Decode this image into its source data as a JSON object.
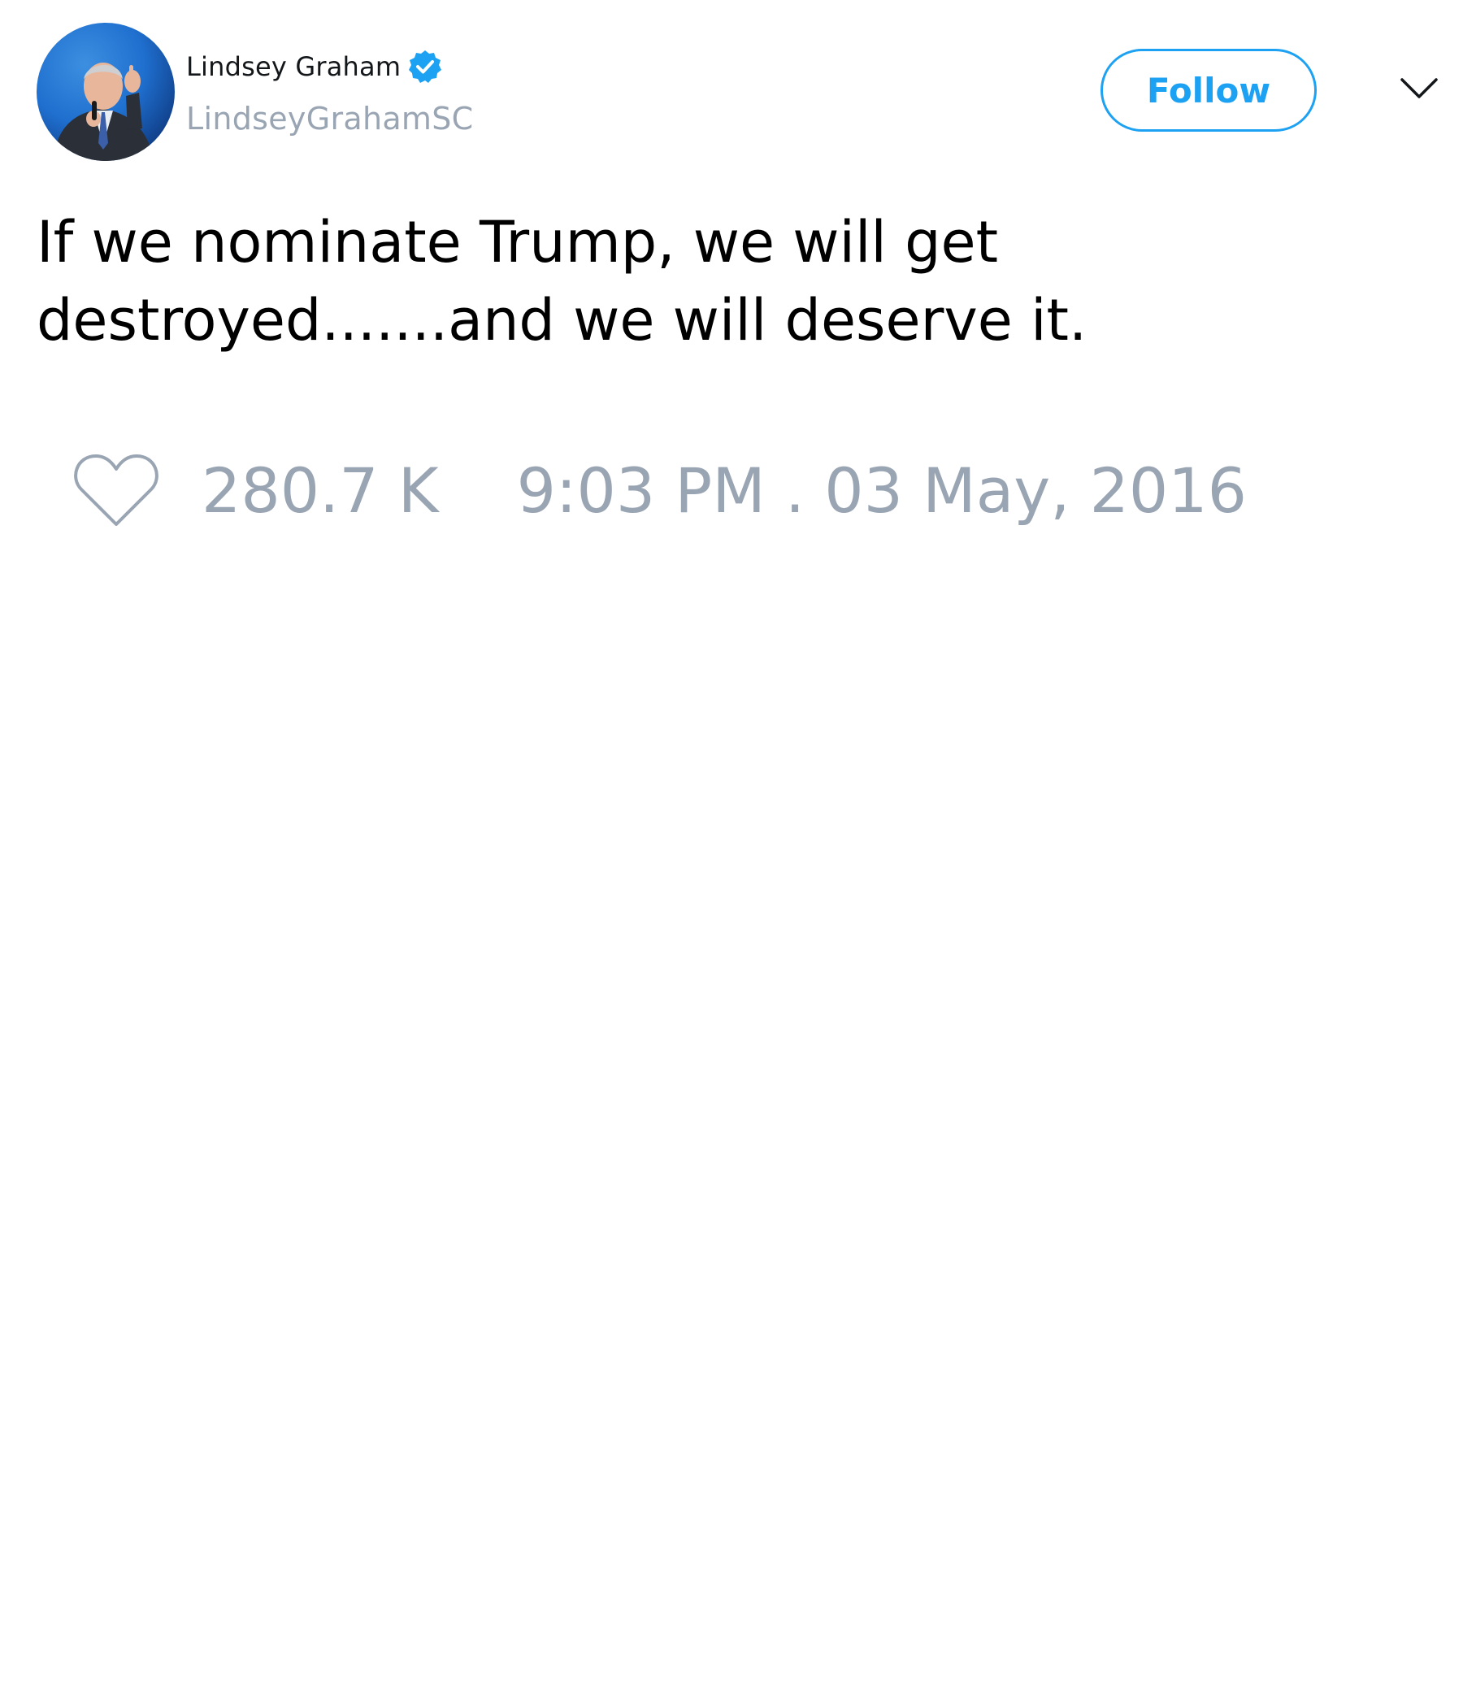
{
  "author": {
    "display_name": "Lindsey Graham",
    "username": "LindseyGrahamSC",
    "verified": true,
    "verified_icon": "verified-badge-icon",
    "avatar_icon": "profile-photo"
  },
  "header": {
    "follow_label": "Follow",
    "menu_icon": "chevron-down-icon"
  },
  "tweet": {
    "text": "If we nominate Trump, we will get destroyed.......and we will deserve it."
  },
  "footer": {
    "like_icon": "heart-icon",
    "like_count": "280.7 K",
    "timestamp": "9:03 PM . 03 May, 2016"
  },
  "colors": {
    "accent": "#1da1f2",
    "muted_text": "#9aa5b4",
    "primary_text": "#000000"
  }
}
